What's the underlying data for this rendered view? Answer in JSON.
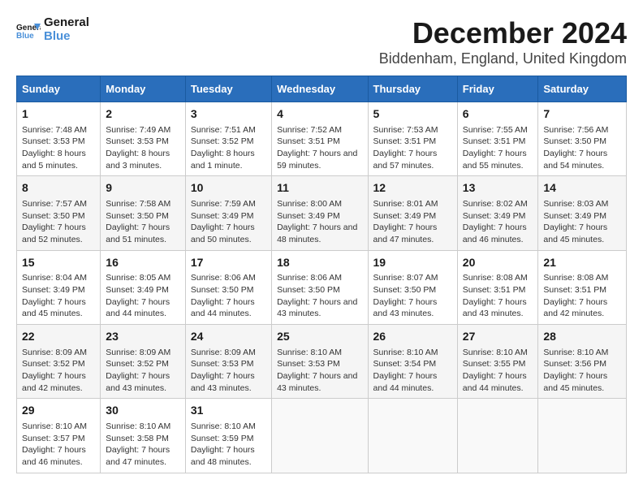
{
  "logo": {
    "line1": "General",
    "line2": "Blue"
  },
  "title": "December 2024",
  "subtitle": "Biddenham, England, United Kingdom",
  "days_header": [
    "Sunday",
    "Monday",
    "Tuesday",
    "Wednesday",
    "Thursday",
    "Friday",
    "Saturday"
  ],
  "weeks": [
    [
      {
        "day": "1",
        "sunrise": "7:48 AM",
        "sunset": "3:53 PM",
        "daylight": "8 hours and 5 minutes."
      },
      {
        "day": "2",
        "sunrise": "7:49 AM",
        "sunset": "3:53 PM",
        "daylight": "8 hours and 3 minutes."
      },
      {
        "day": "3",
        "sunrise": "7:51 AM",
        "sunset": "3:52 PM",
        "daylight": "8 hours and 1 minute."
      },
      {
        "day": "4",
        "sunrise": "7:52 AM",
        "sunset": "3:51 PM",
        "daylight": "7 hours and 59 minutes."
      },
      {
        "day": "5",
        "sunrise": "7:53 AM",
        "sunset": "3:51 PM",
        "daylight": "7 hours and 57 minutes."
      },
      {
        "day": "6",
        "sunrise": "7:55 AM",
        "sunset": "3:51 PM",
        "daylight": "7 hours and 55 minutes."
      },
      {
        "day": "7",
        "sunrise": "7:56 AM",
        "sunset": "3:50 PM",
        "daylight": "7 hours and 54 minutes."
      }
    ],
    [
      {
        "day": "8",
        "sunrise": "7:57 AM",
        "sunset": "3:50 PM",
        "daylight": "7 hours and 52 minutes."
      },
      {
        "day": "9",
        "sunrise": "7:58 AM",
        "sunset": "3:50 PM",
        "daylight": "7 hours and 51 minutes."
      },
      {
        "day": "10",
        "sunrise": "7:59 AM",
        "sunset": "3:49 PM",
        "daylight": "7 hours and 50 minutes."
      },
      {
        "day": "11",
        "sunrise": "8:00 AM",
        "sunset": "3:49 PM",
        "daylight": "7 hours and 48 minutes."
      },
      {
        "day": "12",
        "sunrise": "8:01 AM",
        "sunset": "3:49 PM",
        "daylight": "7 hours and 47 minutes."
      },
      {
        "day": "13",
        "sunrise": "8:02 AM",
        "sunset": "3:49 PM",
        "daylight": "7 hours and 46 minutes."
      },
      {
        "day": "14",
        "sunrise": "8:03 AM",
        "sunset": "3:49 PM",
        "daylight": "7 hours and 45 minutes."
      }
    ],
    [
      {
        "day": "15",
        "sunrise": "8:04 AM",
        "sunset": "3:49 PM",
        "daylight": "7 hours and 45 minutes."
      },
      {
        "day": "16",
        "sunrise": "8:05 AM",
        "sunset": "3:49 PM",
        "daylight": "7 hours and 44 minutes."
      },
      {
        "day": "17",
        "sunrise": "8:06 AM",
        "sunset": "3:50 PM",
        "daylight": "7 hours and 44 minutes."
      },
      {
        "day": "18",
        "sunrise": "8:06 AM",
        "sunset": "3:50 PM",
        "daylight": "7 hours and 43 minutes."
      },
      {
        "day": "19",
        "sunrise": "8:07 AM",
        "sunset": "3:50 PM",
        "daylight": "7 hours and 43 minutes."
      },
      {
        "day": "20",
        "sunrise": "8:08 AM",
        "sunset": "3:51 PM",
        "daylight": "7 hours and 43 minutes."
      },
      {
        "day": "21",
        "sunrise": "8:08 AM",
        "sunset": "3:51 PM",
        "daylight": "7 hours and 42 minutes."
      }
    ],
    [
      {
        "day": "22",
        "sunrise": "8:09 AM",
        "sunset": "3:52 PM",
        "daylight": "7 hours and 42 minutes."
      },
      {
        "day": "23",
        "sunrise": "8:09 AM",
        "sunset": "3:52 PM",
        "daylight": "7 hours and 43 minutes."
      },
      {
        "day": "24",
        "sunrise": "8:09 AM",
        "sunset": "3:53 PM",
        "daylight": "7 hours and 43 minutes."
      },
      {
        "day": "25",
        "sunrise": "8:10 AM",
        "sunset": "3:53 PM",
        "daylight": "7 hours and 43 minutes."
      },
      {
        "day": "26",
        "sunrise": "8:10 AM",
        "sunset": "3:54 PM",
        "daylight": "7 hours and 44 minutes."
      },
      {
        "day": "27",
        "sunrise": "8:10 AM",
        "sunset": "3:55 PM",
        "daylight": "7 hours and 44 minutes."
      },
      {
        "day": "28",
        "sunrise": "8:10 AM",
        "sunset": "3:56 PM",
        "daylight": "7 hours and 45 minutes."
      }
    ],
    [
      {
        "day": "29",
        "sunrise": "8:10 AM",
        "sunset": "3:57 PM",
        "daylight": "7 hours and 46 minutes."
      },
      {
        "day": "30",
        "sunrise": "8:10 AM",
        "sunset": "3:58 PM",
        "daylight": "7 hours and 47 minutes."
      },
      {
        "day": "31",
        "sunrise": "8:10 AM",
        "sunset": "3:59 PM",
        "daylight": "7 hours and 48 minutes."
      },
      null,
      null,
      null,
      null
    ]
  ]
}
